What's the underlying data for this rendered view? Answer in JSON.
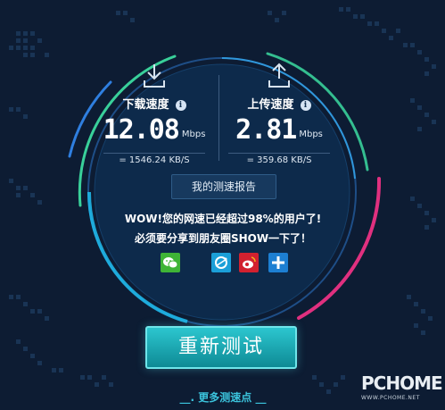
{
  "download": {
    "title": "下载速度",
    "value": "12.08",
    "unit": "Mbps",
    "kbs": "= 1546.24 KB/S"
  },
  "upload": {
    "title": "上传速度",
    "value": "2.81",
    "unit": "Mbps",
    "kbs": "= 359.68 KB/S"
  },
  "info_glyph": "i",
  "report_button": "我的测速报告",
  "result_line": "WOW!您的网速已经超过98%的用户了!",
  "share_line": "必须要分享到朋友圈SHOW一下了！",
  "share_icons": [
    "wechat-icon",
    "qzone-icon",
    "weibo-icon",
    "plus-icon"
  ],
  "retest_button": "重新测试",
  "more_points": "__. 更多测速点 __",
  "watermark": {
    "title": "PCHOME",
    "url": "WWW.PCHOME.NET"
  },
  "colors": {
    "background": "#0d1c33",
    "accent_cyan": "#2cc6cf",
    "ring_green": "#39d09a",
    "ring_blue": "#2f7fe0",
    "ring_pink": "#e0307f",
    "link": "#3bc3dc"
  }
}
